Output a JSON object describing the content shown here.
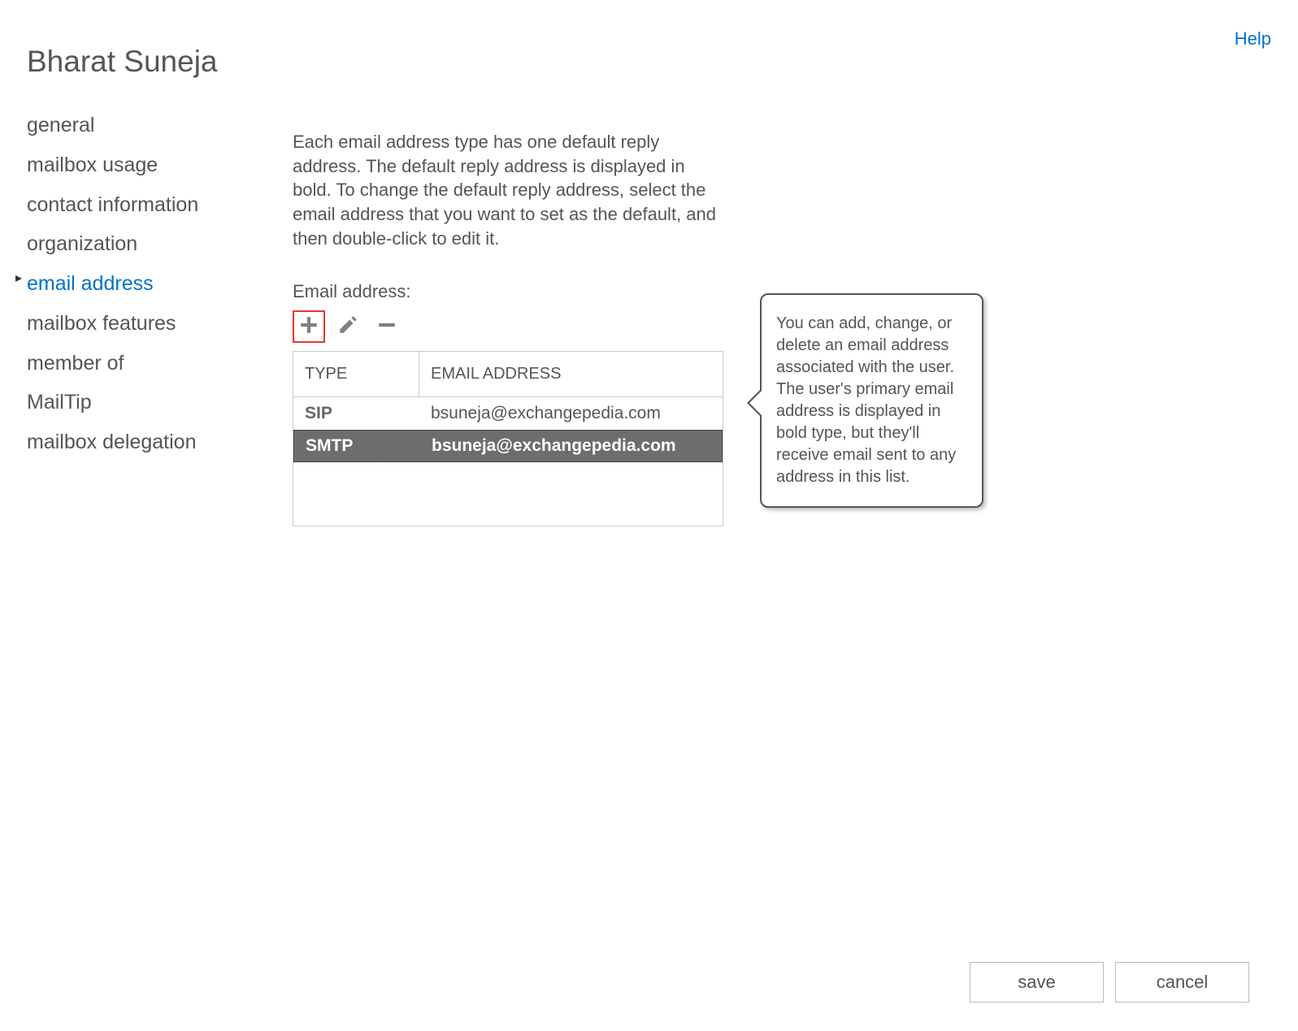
{
  "header": {
    "help_link": "Help",
    "page_title": "Bharat Suneja"
  },
  "sidebar": {
    "items": [
      {
        "label": "general",
        "active": false
      },
      {
        "label": "mailbox usage",
        "active": false
      },
      {
        "label": "contact information",
        "active": false
      },
      {
        "label": "organization",
        "active": false
      },
      {
        "label": "email address",
        "active": true
      },
      {
        "label": "mailbox features",
        "active": false
      },
      {
        "label": "member of",
        "active": false
      },
      {
        "label": "MailTip",
        "active": false
      },
      {
        "label": "mailbox delegation",
        "active": false
      }
    ]
  },
  "content": {
    "description": "Each email address type has one default reply address. The default reply address is displayed in bold. To change the default reply address, select the email address that you want to set as the default, and then double-click to edit it.",
    "section_label": "Email address:",
    "table": {
      "columns": {
        "type": "TYPE",
        "email": "EMAIL ADDRESS"
      },
      "rows": [
        {
          "type": "SIP",
          "email": "bsuneja@exchangepedia.com",
          "selected": false,
          "primary": false
        },
        {
          "type": "SMTP",
          "email": "bsuneja@exchangepedia.com",
          "selected": true,
          "primary": true
        }
      ]
    }
  },
  "callout": {
    "text": "You can add, change, or delete an email address associated with the user. The user's primary email address is displayed in bold type, but they'll receive email sent to any address in this list."
  },
  "footer": {
    "save_label": "save",
    "cancel_label": "cancel"
  },
  "toolbar_icons": {
    "add": "plus-icon",
    "edit": "pencil-icon",
    "remove": "minus-icon"
  }
}
